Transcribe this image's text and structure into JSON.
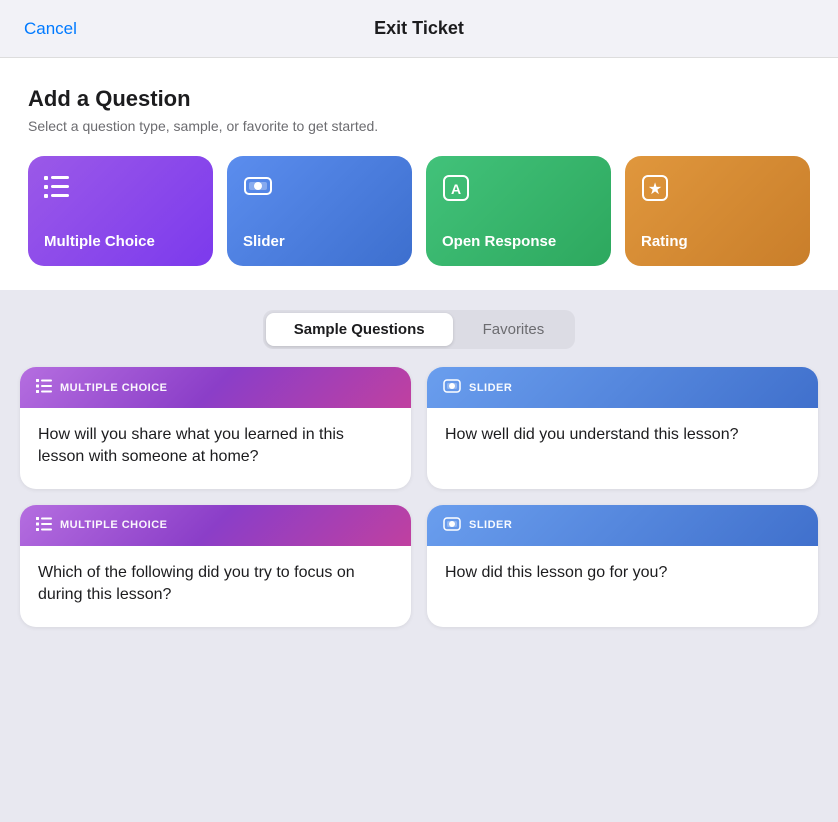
{
  "header": {
    "cancel_label": "Cancel",
    "title": "Exit Ticket"
  },
  "add_question": {
    "title": "Add a Question",
    "subtitle": "Select a question type, sample, or favorite to get started."
  },
  "question_types": [
    {
      "id": "multiple-choice",
      "label": "Multiple Choice",
      "icon": "☰",
      "css_class": "multiple-choice"
    },
    {
      "id": "slider",
      "label": "Slider",
      "icon": "🖥",
      "css_class": "slider"
    },
    {
      "id": "open-response",
      "label": "Open Response",
      "icon": "A",
      "css_class": "open-response"
    },
    {
      "id": "rating",
      "label": "Rating",
      "icon": "★",
      "css_class": "rating"
    }
  ],
  "tabs": [
    {
      "id": "sample",
      "label": "Sample Questions",
      "active": true
    },
    {
      "id": "favorites",
      "label": "Favorites",
      "active": false
    }
  ],
  "sample_questions": [
    {
      "id": 1,
      "type": "MULTIPLE CHOICE",
      "type_css": "mc",
      "question": "How will you share what you learned in this lesson with someone at home?"
    },
    {
      "id": 2,
      "type": "SLIDER",
      "type_css": "sl",
      "question": "How well did you understand this lesson?"
    },
    {
      "id": 3,
      "type": "MULTIPLE CHOICE",
      "type_css": "mc",
      "question": "Which of the following did you try to focus on during this lesson?"
    },
    {
      "id": 4,
      "type": "SLIDER",
      "type_css": "sl",
      "question": "How did this lesson go for you?"
    }
  ]
}
